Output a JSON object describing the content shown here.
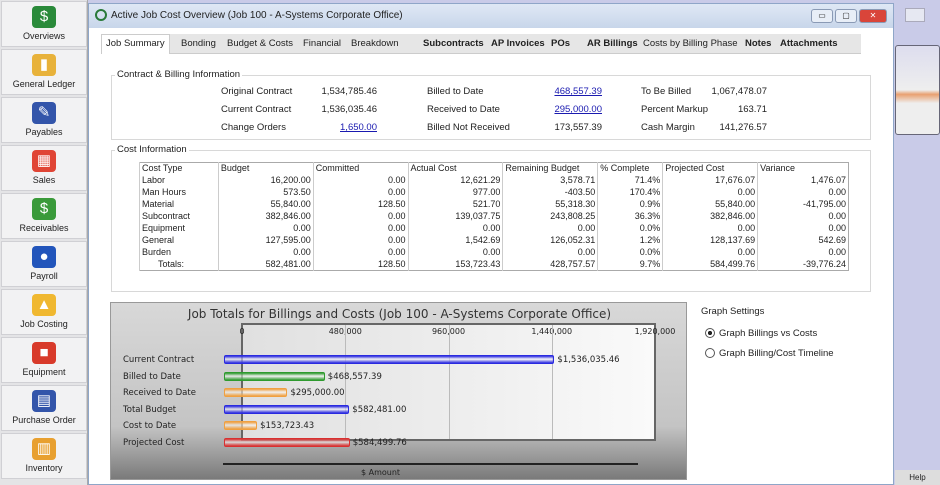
{
  "sidebar": {
    "items": [
      {
        "label": "Overviews",
        "icon": "magnifier-dollar-icon",
        "color": "#2a8a3a"
      },
      {
        "label": "General Ledger",
        "icon": "book-icon",
        "color": "#e8b23a"
      },
      {
        "label": "Payables",
        "icon": "check-pen-icon",
        "color": "#3355aa"
      },
      {
        "label": "Sales",
        "icon": "register-icon",
        "color": "#e04535"
      },
      {
        "label": "Receivables",
        "icon": "cash-icon",
        "color": "#3a9a3a"
      },
      {
        "label": "Payroll",
        "icon": "people-icon",
        "color": "#2255bb"
      },
      {
        "label": "Job Costing",
        "icon": "hardhat-icon",
        "color": "#f0b830"
      },
      {
        "label": "Equipment",
        "icon": "dump-truck-icon",
        "color": "#d83a2a"
      },
      {
        "label": "Purchase Order",
        "icon": "document-icon",
        "color": "#3355aa"
      },
      {
        "label": "Inventory",
        "icon": "hand-truck-icon",
        "color": "#e8a030"
      }
    ]
  },
  "window": {
    "title": "Active Job Cost Overview (Job 100 - A-Systems Corporate Office)"
  },
  "tabs": [
    "Job Summary",
    "Bonding",
    "Budget & Costs",
    "Financial",
    "Breakdown",
    "Subcontracts",
    "AP Invoices",
    "POs",
    "AR Billings",
    "Costs by Billing Phase",
    "Notes",
    "Attachments"
  ],
  "contract": {
    "title": "Contract & Billing Information",
    "fields": [
      {
        "label": "Original Contract",
        "value": "1,534,785.46"
      },
      {
        "label": "Current Contract",
        "value": "1,536,035.46"
      },
      {
        "label": "Change Orders",
        "value": "1,650.00"
      },
      {
        "label": "Billed to Date",
        "value": "468,557.39"
      },
      {
        "label": "Received to Date",
        "value": "295,000.00"
      },
      {
        "label": "Billed Not Received",
        "value": "173,557.39"
      },
      {
        "label": "To Be Billed",
        "value": "1,067,478.07"
      },
      {
        "label": "Percent Markup",
        "value": "163.71"
      },
      {
        "label": "Cash Margin",
        "value": "141,276.57"
      }
    ]
  },
  "cost": {
    "title": "Cost Information",
    "headers": [
      "Cost Type",
      "Budget",
      "Committed",
      "Actual Cost",
      "Remaining Budget",
      "% Complete",
      "Projected Cost",
      "Variance"
    ],
    "rows": [
      [
        "Labor",
        "16,200.00",
        "0.00",
        "12,621.29",
        "3,578.71",
        "71.4%",
        "17,676.07",
        "1,476.07"
      ],
      [
        "Man Hours",
        "573.50",
        "0.00",
        "977.00",
        "-403.50",
        "170.4%",
        "0.00",
        "0.00"
      ],
      [
        "Material",
        "55,840.00",
        "128.50",
        "521.70",
        "55,318.30",
        "0.9%",
        "55,840.00",
        "-41,795.00"
      ],
      [
        "Subcontract",
        "382,846.00",
        "0.00",
        "139,037.75",
        "243,808.25",
        "36.3%",
        "382,846.00",
        "0.00"
      ],
      [
        "Equipment",
        "0.00",
        "0.00",
        "0.00",
        "0.00",
        "0.0%",
        "0.00",
        "0.00"
      ],
      [
        "General",
        "127,595.00",
        "0.00",
        "1,542.69",
        "126,052.31",
        "1.2%",
        "128,137.69",
        "542.69"
      ],
      [
        "Burden",
        "0.00",
        "0.00",
        "0.00",
        "0.00",
        "0.0%",
        "0.00",
        "0.00"
      ],
      [
        "Totals:",
        "582,481.00",
        "128.50",
        "153,723.43",
        "428,757.57",
        "9.7%",
        "584,499.76",
        "-39,776.24"
      ]
    ]
  },
  "chart_data": {
    "type": "bar",
    "title": "Job Totals for Billings and Costs (Job 100 - A-Systems Corporate Office)",
    "xlabel": "$ Amount",
    "ylabel": "",
    "xlim": [
      0,
      1920000
    ],
    "ticks": [
      "0",
      "480,000",
      "960,000",
      "1,440,000",
      "1,920,000"
    ],
    "tick_values": [
      0,
      480000,
      960000,
      1440000,
      1920000
    ],
    "categories": [
      "Current Contract",
      "Billed to Date",
      "Received to Date",
      "Total Budget",
      "Cost to Date",
      "Projected Cost"
    ],
    "values": [
      1536035.46,
      468557.39,
      295000.0,
      582481.0,
      153723.43,
      584499.76
    ],
    "labels": [
      "$1,536,035.46",
      "$468,557.39",
      "$295,000.00",
      "$582,481.00",
      "$153,723.43",
      "$584,499.76"
    ],
    "colors": [
      "#2a2ae0",
      "#2e9a2e",
      "#f0a040",
      "#2a2ae0",
      "#f0a040",
      "#d83030"
    ]
  },
  "settings": {
    "title": "Graph Settings",
    "options": [
      "Graph Billings vs Costs",
      "Graph Billing/Cost Timeline"
    ],
    "selected": 0
  },
  "footer": {
    "help": "Help"
  }
}
